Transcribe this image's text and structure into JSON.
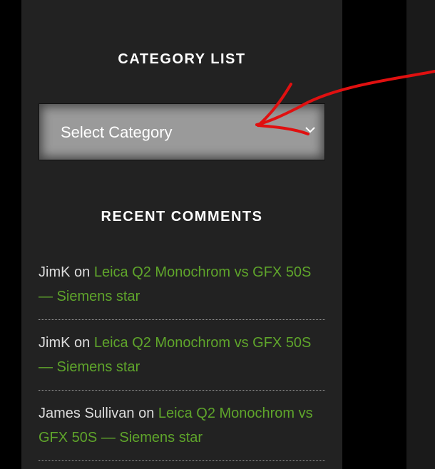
{
  "category_widget": {
    "title": "CATEGORY LIST",
    "select_value": "Select Category"
  },
  "recent_comments": {
    "title": "RECENT COMMENTS",
    "items": [
      {
        "author": "JimK",
        "on": "on",
        "post": "Leica Q2 Monochrom vs GFX 50S — Siemens star"
      },
      {
        "author": "JimK",
        "on": "on",
        "post": "Leica Q2 Monochrom vs GFX 50S — Siemens star"
      },
      {
        "author": "James Sullivan",
        "on": "on",
        "post": "Leica Q2 Monochrom vs GFX 50S — Siemens star"
      }
    ]
  },
  "colors": {
    "sidebar_bg": "#222222",
    "link": "#5fa52b",
    "annotation_arrow": "#e01010"
  },
  "icons": {
    "dropdown": "chevron-down-icon",
    "annotation": "red-arrow-annotation"
  }
}
